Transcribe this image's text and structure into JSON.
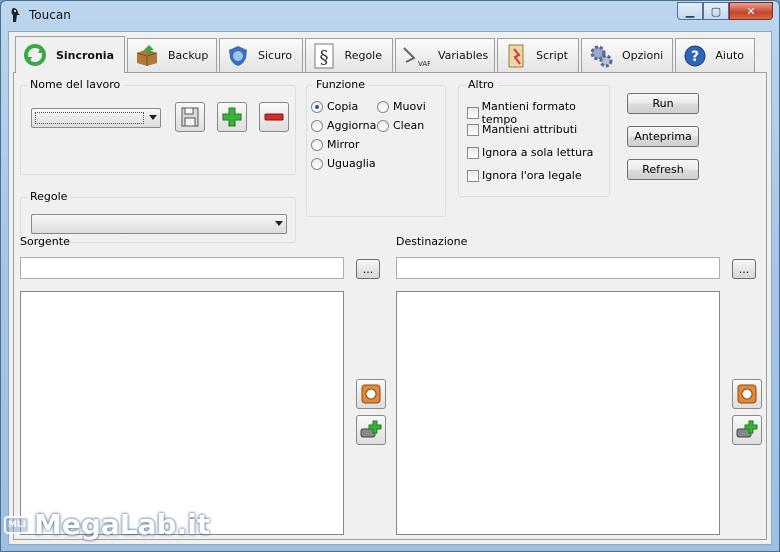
{
  "window": {
    "title": "Toucan",
    "min_glyph": "▁",
    "max_glyph": "▢",
    "close_glyph": "✕"
  },
  "tabs": [
    {
      "label": "Sincronia",
      "icon": "sync-arrows-icon",
      "active": true
    },
    {
      "label": "Backup",
      "icon": "box-icon",
      "active": false
    },
    {
      "label": "Sicuro",
      "icon": "shield-icon",
      "active": false
    },
    {
      "label": "Regole",
      "icon": "paragraph-icon",
      "active": false
    },
    {
      "label": "Variables",
      "icon": "var-icon",
      "active": false
    },
    {
      "label": "Script",
      "icon": "script-icon",
      "active": false
    },
    {
      "label": "Opzioni",
      "icon": "gears-icon",
      "active": false
    },
    {
      "label": "Aiuto",
      "icon": "help-icon",
      "active": false
    }
  ],
  "job": {
    "group_title": "Nome del lavoro",
    "selected": ""
  },
  "rules": {
    "group_title": "Regole",
    "selected": ""
  },
  "function": {
    "group_title": "Funzione",
    "options": [
      "Copia",
      "Aggiorna",
      "Mirror",
      "Uguaglia",
      "Muovi",
      "Clean"
    ],
    "selected": "Copia"
  },
  "other": {
    "group_title": "Altro",
    "options": [
      "Mantieni formato tempo",
      "Mantieni attributi",
      "Ignora a sola lettura",
      "Ignora l'ora legale"
    ]
  },
  "actions": {
    "run": "Run",
    "preview": "Anteprima",
    "refresh": "Refresh"
  },
  "source": {
    "label": "Sorgente",
    "path": "",
    "browse": "..."
  },
  "destination": {
    "label": "Destinazione",
    "path": "",
    "browse": "..."
  },
  "watermark": {
    "text": "MegaLab.it",
    "badge": "MLI"
  },
  "colors": {
    "titlebar": "#a9c7e6",
    "panel": "#f0f0f0",
    "add_green": "#3bb33b",
    "remove_red": "#d22d2d",
    "radio_dot": "#2b5a9c"
  }
}
